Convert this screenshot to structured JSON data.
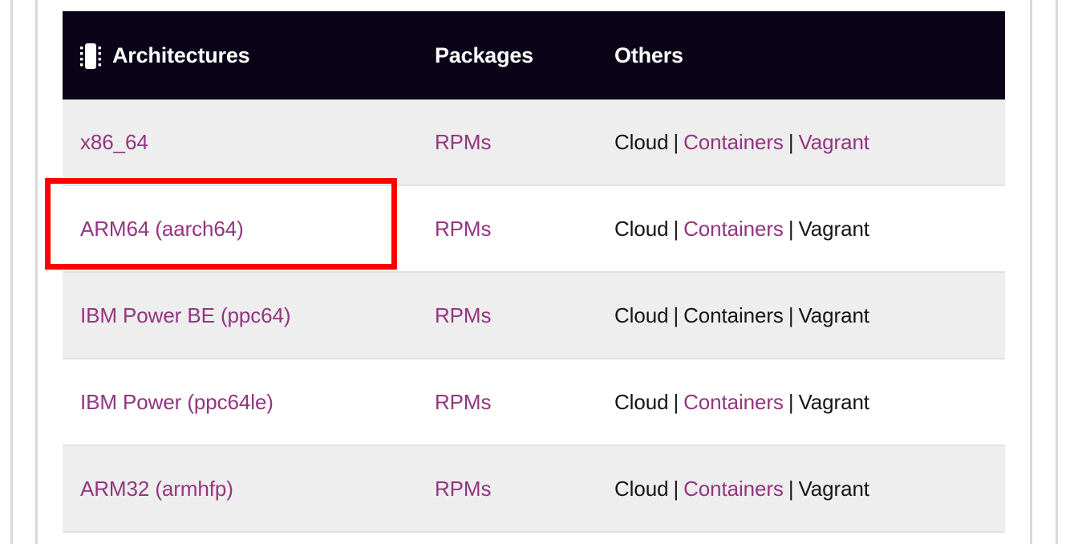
{
  "table": {
    "icon": "memory-chip-icon",
    "headers": [
      "Architectures",
      "Packages",
      "Others"
    ],
    "rows": [
      {
        "architecture": "x86_64",
        "architecture_is_link": true,
        "packages": "RPMs",
        "packages_is_link": true,
        "others": [
          {
            "label": "Cloud",
            "is_link": false
          },
          {
            "label": "Containers",
            "is_link": true
          },
          {
            "label": "Vagrant",
            "is_link": true
          }
        ],
        "separator": "|",
        "shaded": true,
        "highlighted": false
      },
      {
        "architecture": "ARM64 (aarch64)",
        "architecture_is_link": true,
        "packages": "RPMs",
        "packages_is_link": true,
        "others": [
          {
            "label": "Cloud",
            "is_link": false
          },
          {
            "label": "Containers",
            "is_link": true
          },
          {
            "label": "Vagrant",
            "is_link": false
          }
        ],
        "separator": "|",
        "shaded": false,
        "highlighted": true
      },
      {
        "architecture": "IBM Power BE (ppc64)",
        "architecture_is_link": true,
        "packages": "RPMs",
        "packages_is_link": true,
        "others": [
          {
            "label": "Cloud",
            "is_link": false
          },
          {
            "label": "Containers",
            "is_link": false
          },
          {
            "label": "Vagrant",
            "is_link": false
          }
        ],
        "separator": "|",
        "shaded": true,
        "highlighted": false
      },
      {
        "architecture": "IBM Power (ppc64le)",
        "architecture_is_link": true,
        "packages": "RPMs",
        "packages_is_link": true,
        "others": [
          {
            "label": "Cloud",
            "is_link": false
          },
          {
            "label": "Containers",
            "is_link": true
          },
          {
            "label": "Vagrant",
            "is_link": false
          }
        ],
        "separator": "|",
        "shaded": false,
        "highlighted": false
      },
      {
        "architecture": "ARM32 (armhfp)",
        "architecture_is_link": true,
        "packages": "RPMs",
        "packages_is_link": true,
        "others": [
          {
            "label": "Cloud",
            "is_link": false
          },
          {
            "label": "Containers",
            "is_link": true
          },
          {
            "label": "Vagrant",
            "is_link": false
          }
        ],
        "separator": "|",
        "shaded": true,
        "highlighted": false
      }
    ]
  },
  "colors": {
    "header_background": "#0b0318",
    "header_text": "#ffffff",
    "link": "#93357f",
    "body_text": "#151419",
    "row_shaded": "#eeeeee",
    "row_plain": "#ffffff",
    "row_border": "#dfe2e5",
    "highlight_box": "#fe0000",
    "guide_rule": "#d7d9dc"
  }
}
